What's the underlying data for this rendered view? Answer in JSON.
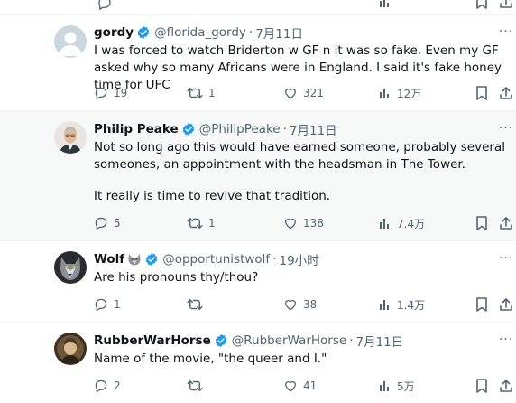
{
  "tweets": [
    {
      "name": "gordy",
      "handle": "@florida_gordy",
      "time": "7月11日",
      "text": [
        "I was forced to watch Briderton w GF n it was so fake. Even my GF asked why so many Africans were in England. I said it's fake honey time for UFC"
      ],
      "replies": "19",
      "retweets": "1",
      "likes": "321",
      "views": "12万"
    },
    {
      "name": "Philip Peake",
      "handle": "@PhilipPeake",
      "time": "7月11日",
      "text": [
        "Not so long ago this would have earned someone, probably several someones, an appointment with the headsman in The Tower.",
        "It really is time to revive that tradition."
      ],
      "replies": "5",
      "retweets": "1",
      "likes": "138",
      "views": "7.4万"
    },
    {
      "name": "Wolf",
      "handle": "@opportunistwolf",
      "time": "19小时",
      "text": [
        "Are his pronouns thy/thou?"
      ],
      "replies": "1",
      "retweets": "",
      "likes": "38",
      "views": "1.4万"
    },
    {
      "name": "RubberWarHorse",
      "handle": "@RubberWarHorse",
      "time": "7月11日",
      "text": [
        "Name of the movie, \"the queer and I.\""
      ],
      "replies": "2",
      "retweets": "",
      "likes": "41",
      "views": "5万"
    }
  ],
  "separator": "·",
  "icons": {
    "verified": "verified-badge-icon",
    "reply": "reply-icon",
    "retweet": "retweet-icon",
    "like": "heart-icon",
    "views": "views-chart-icon",
    "bookmark": "bookmark-icon",
    "share": "share-icon",
    "more": "more-dots-icon",
    "wolf_emoji": "wolf-emoji-icon"
  },
  "colors": {
    "verified": "#1d9bf0",
    "muted": "#536471",
    "text": "#0f1419",
    "highlight_bg": "#f7f9f9",
    "divider": "#eff3f4"
  }
}
